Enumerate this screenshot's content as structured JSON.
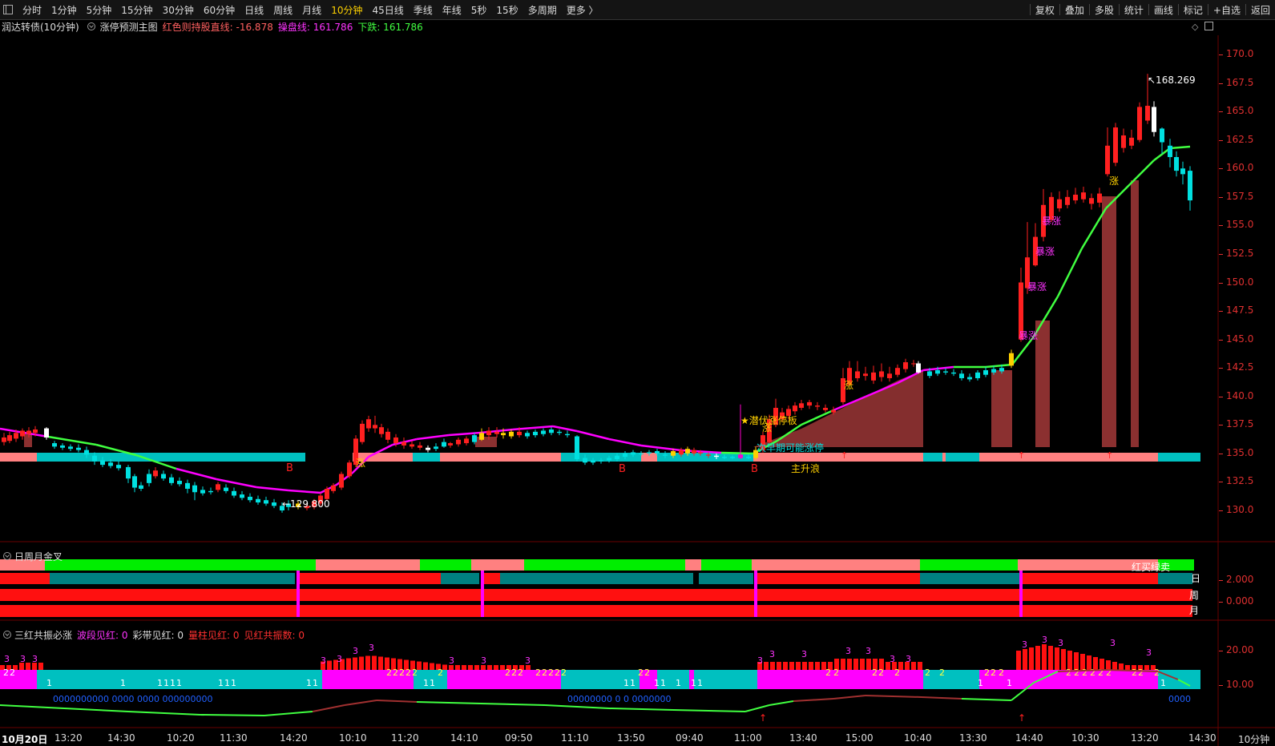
{
  "toolbar": {
    "periods": [
      {
        "label": "分时",
        "active": false
      },
      {
        "label": "1分钟",
        "active": false
      },
      {
        "label": "5分钟",
        "active": false
      },
      {
        "label": "15分钟",
        "active": false
      },
      {
        "label": "30分钟",
        "active": false
      },
      {
        "label": "60分钟",
        "active": false
      },
      {
        "label": "日线",
        "active": false
      },
      {
        "label": "周线",
        "active": false
      },
      {
        "label": "月线",
        "active": false
      },
      {
        "label": "10分钟",
        "active": true
      },
      {
        "label": "45日线",
        "active": false
      },
      {
        "label": "季线",
        "active": false
      },
      {
        "label": "年线",
        "active": false
      },
      {
        "label": "5秒",
        "active": false
      },
      {
        "label": "15秒",
        "active": false
      },
      {
        "label": "多周期",
        "active": false
      },
      {
        "label": "更多 〉",
        "active": false
      }
    ],
    "right": [
      "复权",
      "叠加",
      "多股",
      "统计",
      "画线",
      "标记",
      "+自选",
      "返回"
    ]
  },
  "info": {
    "stock": "润达转债(10分钟)",
    "indicator": "涨停预测主图",
    "red_label": "红色则持股直线: -16.878",
    "cao_label": "操盘线: 161.786",
    "down_label": "下跌: 161.786"
  },
  "main": {
    "price_axis": [
      "170.0",
      "167.5",
      "165.0",
      "162.5",
      "160.0",
      "157.5",
      "155.0",
      "152.5",
      "150.0",
      "147.5",
      "145.0",
      "142.5",
      "140.0",
      "137.5",
      "135.0",
      "132.5",
      "130.0"
    ],
    "high_label": "168.269",
    "low_label": "129.800",
    "annotations": {
      "b1": "B",
      "b2": "B",
      "b3": "B",
      "zhang1": "涨",
      "zhang2": "涨",
      "zhang3": "涨",
      "zhang4": "涨",
      "baozhang1": "暴涨",
      "baozhang2": "暴涨",
      "baozhang3": "暴涨",
      "baozhang4": "暴涨",
      "qianfu": "★潜伏涨停板",
      "zaoqi": "次早期可能涨停",
      "zhusheng": "主升浪"
    }
  },
  "pane2": {
    "title": "日周月金叉",
    "axis": [
      "2.000",
      "0.000"
    ],
    "labels": {
      "buysell": "红买绿卖",
      "day": "日",
      "week": "周",
      "month": "月"
    }
  },
  "pane3": {
    "title": "三红共振必涨",
    "stats": [
      {
        "label": "波段见红: 0",
        "color": "#ff33ff"
      },
      {
        "label": "彩带见红: 0",
        "color": "#dddddd"
      },
      {
        "label": "量柱见红: 0",
        "color": "#ff3030"
      },
      {
        "label": "见红共振数: 0",
        "color": "#ff3030"
      }
    ],
    "axis": [
      "20.00",
      "10.00"
    ]
  },
  "time_axis": [
    "10月20日",
    "13:20",
    "14:30",
    "10:20",
    "11:30",
    "14:20",
    "10:10",
    "11:20",
    "14:10",
    "09:50",
    "11:10",
    "13:50",
    "09:40",
    "11:00",
    "13:40",
    "15:00",
    "10:40",
    "13:30",
    "14:40",
    "10:30",
    "13:20",
    "14:30"
  ],
  "period_label": "10分钟",
  "colors": {
    "up": "#ff2020",
    "down": "#00e0e0",
    "magenta": "#ff00ff",
    "green": "#40ff40",
    "pink": "#ff8080",
    "teal": "#00c0c0",
    "axis": "#e03030"
  }
}
